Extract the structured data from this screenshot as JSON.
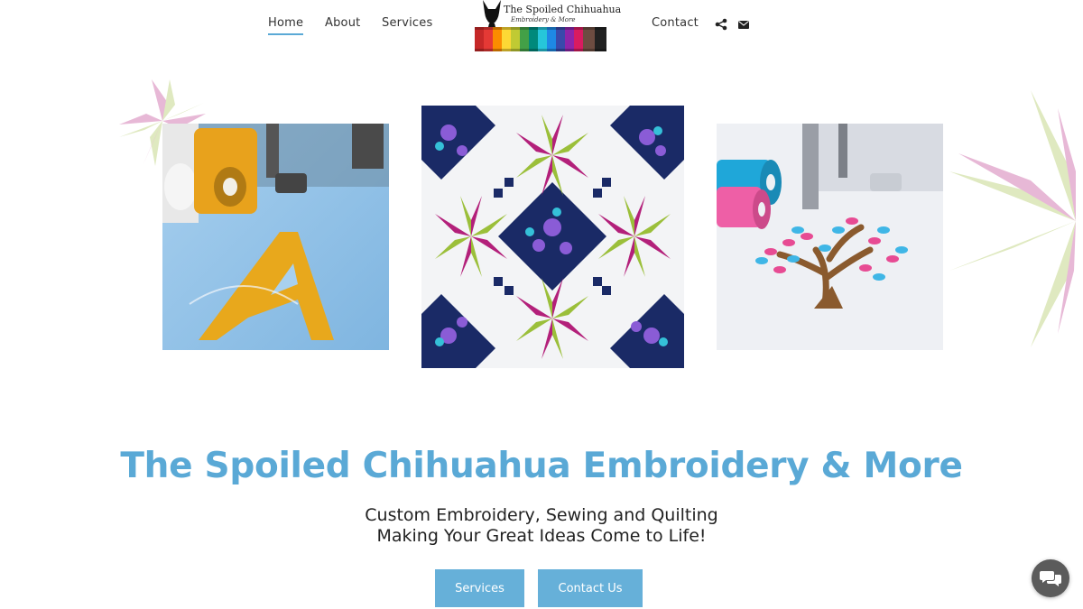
{
  "header": {
    "nav": {
      "home": "Home",
      "about": "About",
      "services": "Services",
      "contact": "Contact"
    },
    "icons": {
      "share": "share-icon",
      "email": "envelope-icon"
    },
    "logo": {
      "name": "The Spoiled Chihuahua",
      "subtitle": "Embroidery & More"
    }
  },
  "hero": {
    "title": "The Spoiled Chihuahua Embroidery & More",
    "tagline_line1": "Custom Embroidery, Sewing and Quilting",
    "tagline_line2": "Making Your Great Ideas Come to Life!",
    "buttons": {
      "services": "Services",
      "contact": "Contact Us"
    }
  },
  "colors": {
    "accent": "#5aa9d6",
    "button": "#66b0d9",
    "deco_pink": "#e7b8d6",
    "deco_green": "#dfe9c0"
  },
  "widgets": {
    "chat_icon": "chat-bubbles-icon"
  }
}
